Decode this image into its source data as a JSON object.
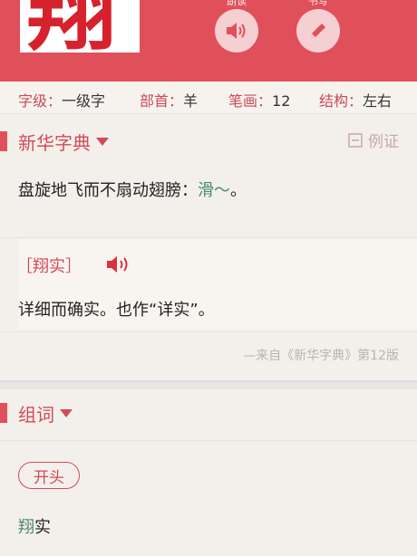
{
  "header": {
    "character": "翔",
    "read_caption": "朗读",
    "write_caption": "书写"
  },
  "info": {
    "level_label": "字级：",
    "level_value": "一级字",
    "radical_label": "部首：",
    "radical_value": "羊",
    "strokes_label": "笔画：",
    "strokes_value": "12",
    "structure_label": "结构：",
    "structure_value": "左右"
  },
  "xinhua": {
    "title": "新华字典",
    "example_label": "例证",
    "definition": "盘旋地飞而不扇动翅膀：",
    "definition_example": "滑～",
    "definition_end": "。",
    "entry_term": "［翔实］",
    "entry_definition": "详细而确实。也作“详实”。",
    "source": "—来自《新华字典》第12版"
  },
  "words": {
    "title": "组词",
    "filter_label": "开头",
    "items": [
      {
        "first": "翔",
        "rest": "实"
      }
    ]
  },
  "colors": {
    "accent": "#e0505a",
    "link_green": "#4a8a6a"
  }
}
